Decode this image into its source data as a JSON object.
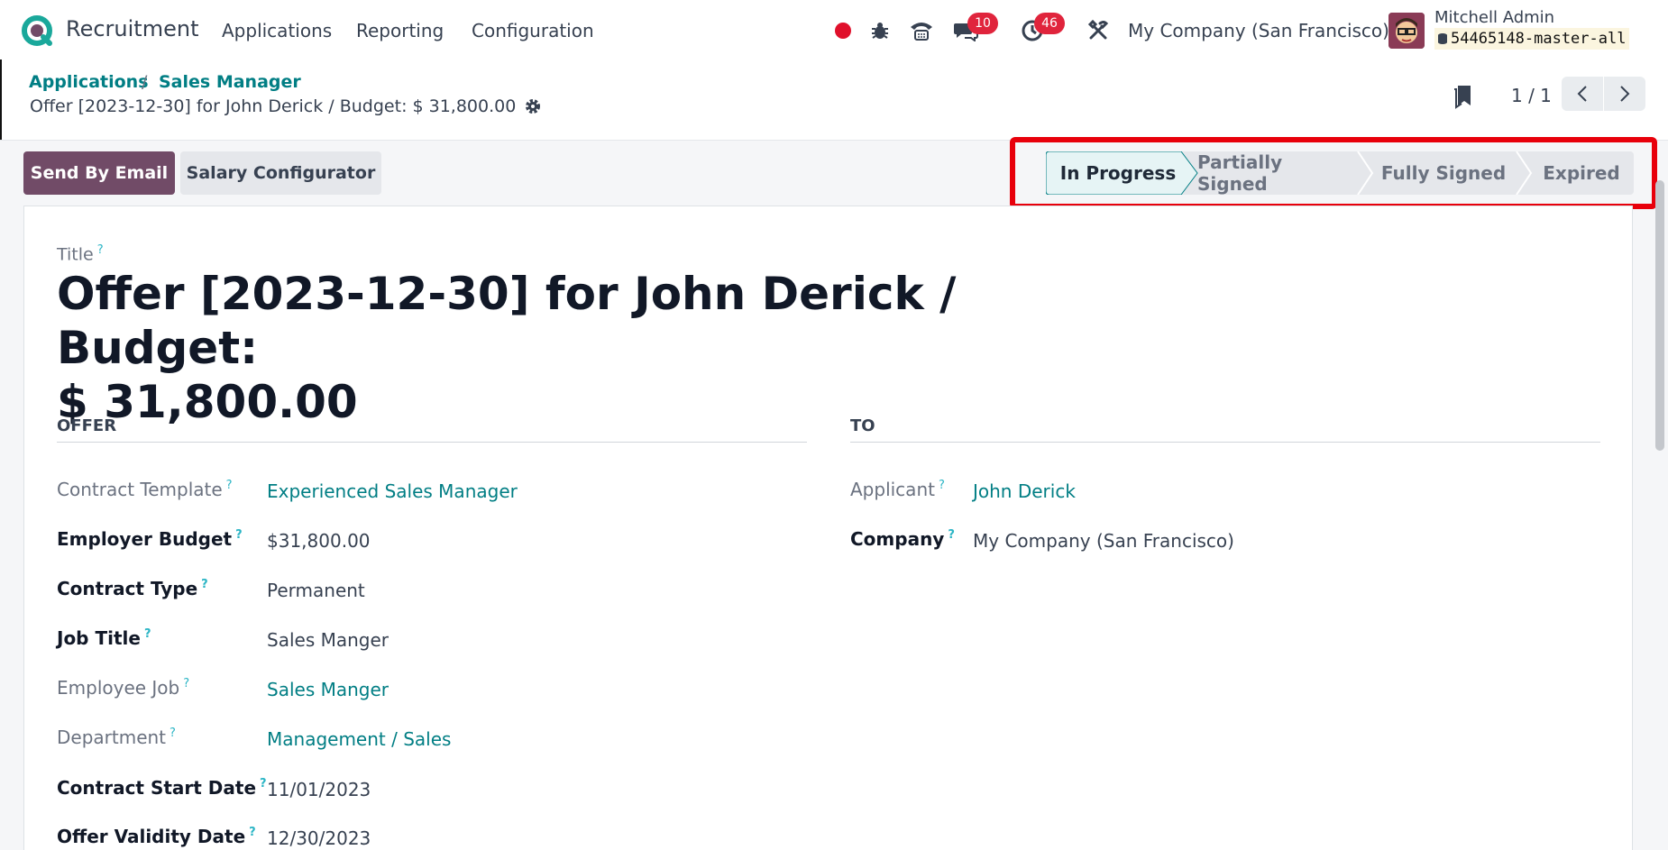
{
  "navbar": {
    "app_name": "Recruitment",
    "menu": [
      "Applications",
      "Reporting",
      "Configuration"
    ],
    "messages_count": "10",
    "activities_count": "46",
    "company": "My Company (San Francisco)",
    "user_name": "Mitchell Admin",
    "database": "54465148-master-all"
  },
  "breadcrumb": {
    "parent": "Applications",
    "current": "Sales Manager",
    "separator": "/",
    "record_title": "Offer [2023-12-30] for John Derick / Budget: $ 31,800.00"
  },
  "pager": {
    "value": "1 / 1"
  },
  "buttons": {
    "send_by_email": "Send By Email",
    "salary_configurator": "Salary Configurator"
  },
  "statusbar": {
    "stages": [
      "In Progress",
      "Partially Signed",
      "Fully Signed",
      "Expired"
    ],
    "active": "In Progress"
  },
  "form": {
    "title_label": "Title",
    "title_line1": "Offer [2023-12-30] for John Derick / Budget:",
    "title_line2": "$ 31,800.00",
    "offer_section": "OFFER",
    "to_section": "TO",
    "tooltip_mark": "?",
    "offer_fields": [
      {
        "label": "Contract Template",
        "value": "Experienced Sales Manager"
      },
      {
        "label": "Employer Budget",
        "value": "$31,800.00"
      },
      {
        "label": "Contract Type",
        "value": "Permanent"
      },
      {
        "label": "Job Title",
        "value": "Sales Manger"
      },
      {
        "label": "Employee Job",
        "value": "Sales Manger"
      },
      {
        "label": "Department",
        "value": "Management / Sales"
      },
      {
        "label": "Contract Start Date",
        "value": "11/01/2023"
      },
      {
        "label": "Offer Validity Date",
        "value": "12/30/2023"
      }
    ],
    "to_fields": [
      {
        "label": "Applicant",
        "value": "John Derick"
      },
      {
        "label": "Company",
        "value": "My Company (San Francisco)"
      }
    ]
  },
  "colors": {
    "brand": "#714b67",
    "link": "#017e84",
    "badge": "#e0243c",
    "highlight": "#e8000b",
    "active_stage_bg": "#e6f4f5"
  }
}
